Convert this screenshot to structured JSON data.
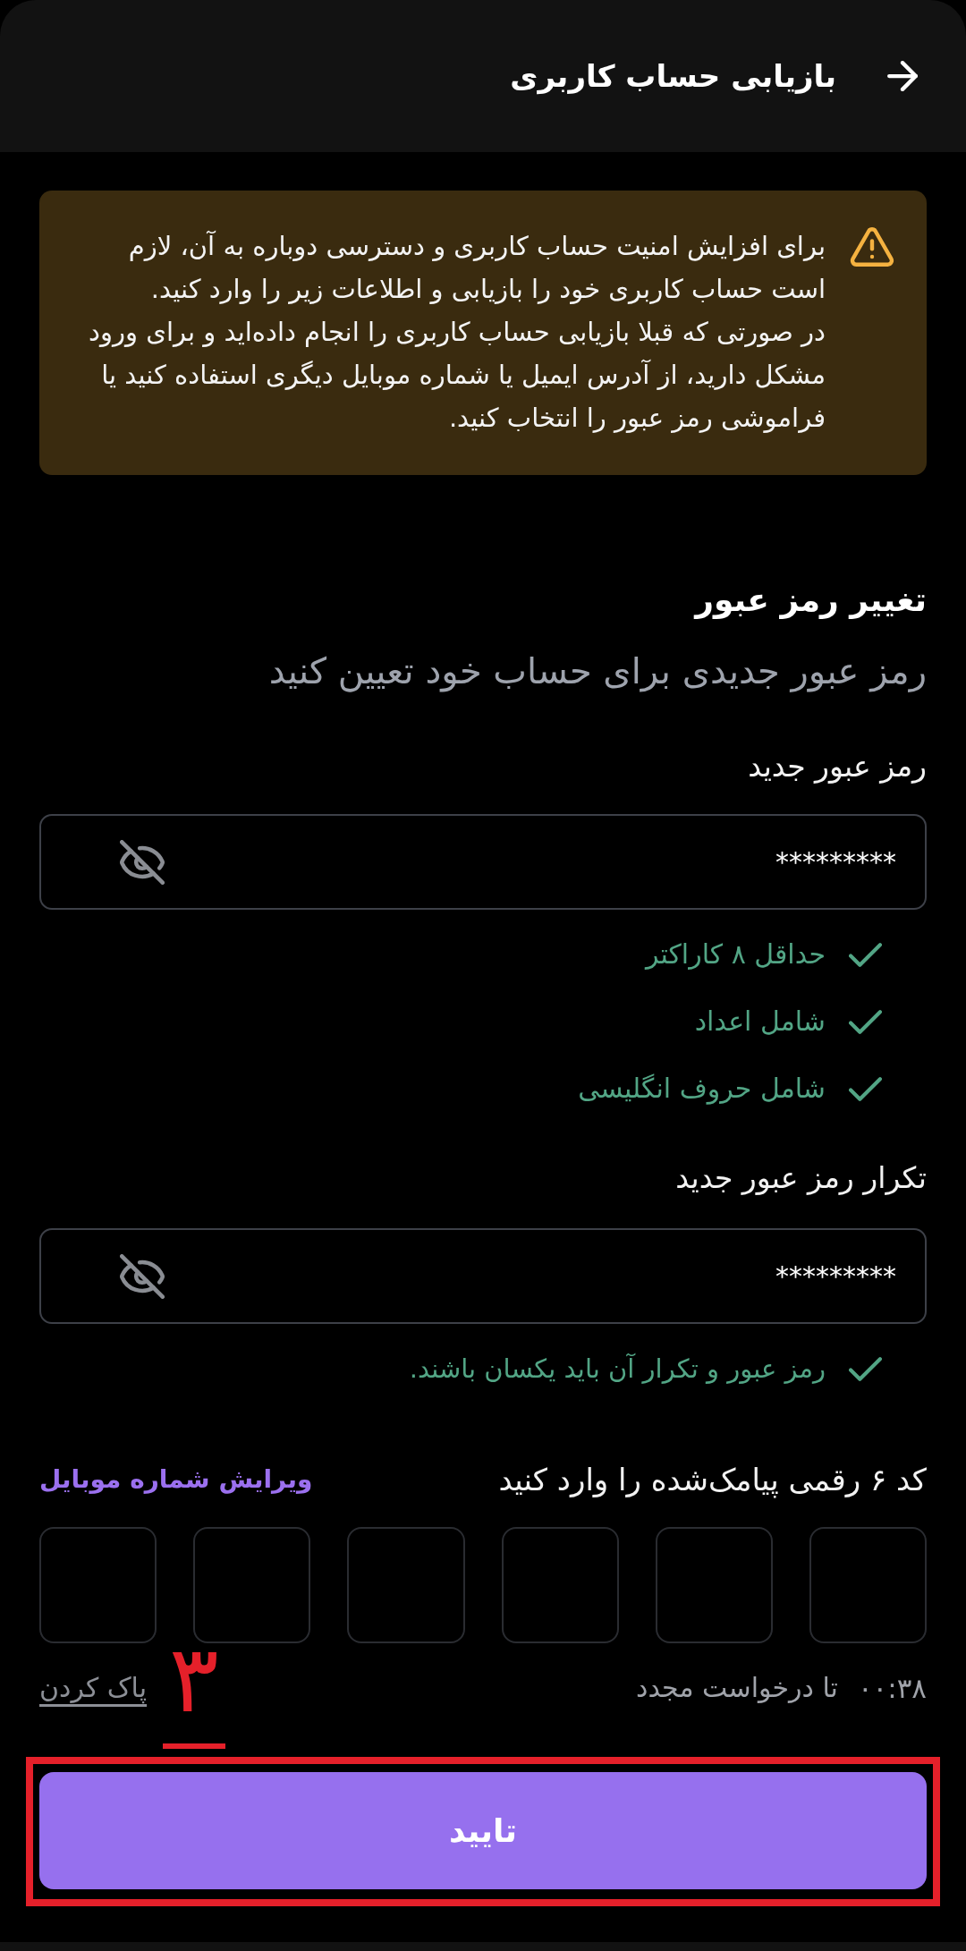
{
  "header": {
    "title": "بازیابی حساب کاربری"
  },
  "notice": {
    "paragraphs": [
      "برای افزایش امنیت حساب کاربری و دسترسی دوباره به آن، لازم است حساب کاربری خود را بازیابی و اطلاعات زیر را وارد کنید.",
      "در صورتی که قبلا بازیابی حساب کاربری را انجام داده‌اید و برای ورود مشکل دارید، از آدرس ایمیل یا شماره موبایل دیگری استفاده کنید یا فراموشی رمز عبور را انتخاب کنید."
    ]
  },
  "section": {
    "title": "تغییر رمز عبور",
    "subtitle": "رمز عبور جدیدی برای حساب خود تعیین کنید"
  },
  "fields": [
    {
      "label": "رمز عبور جدید",
      "value": "*********",
      "password_visible": false,
      "checks": [
        {
          "text": "حداقل ۸ کاراکتر",
          "met": true
        },
        {
          "text": "شامل اعداد",
          "met": true
        },
        {
          "text": "شامل حروف انگلیسی",
          "met": true
        }
      ]
    },
    {
      "label": "تکرار رمز عبور جدید",
      "value": "*********",
      "password_visible": false,
      "checks": [
        {
          "text": "رمز عبور و تکرار آن باید یکسان باشند.",
          "met": true
        }
      ]
    }
  ],
  "otp": {
    "label": "کد ۶ رقمی پیامک‌شده را وارد کنید",
    "edit_link": "ویرایش شماره موبایل",
    "cells": [
      {
        "focused": false
      },
      {
        "focused": false
      },
      {
        "focused": false
      },
      {
        "focused": false
      },
      {
        "focused": false
      },
      {
        "focused": false
      }
    ],
    "timer": "۰۰:۳۸",
    "resend_text": "تا درخواست مجدد",
    "clear_link": "پاک کردن"
  },
  "confirm_button": {
    "label": "تایید"
  },
  "annotation": {
    "step": "۳",
    "highlight_button": true
  }
}
